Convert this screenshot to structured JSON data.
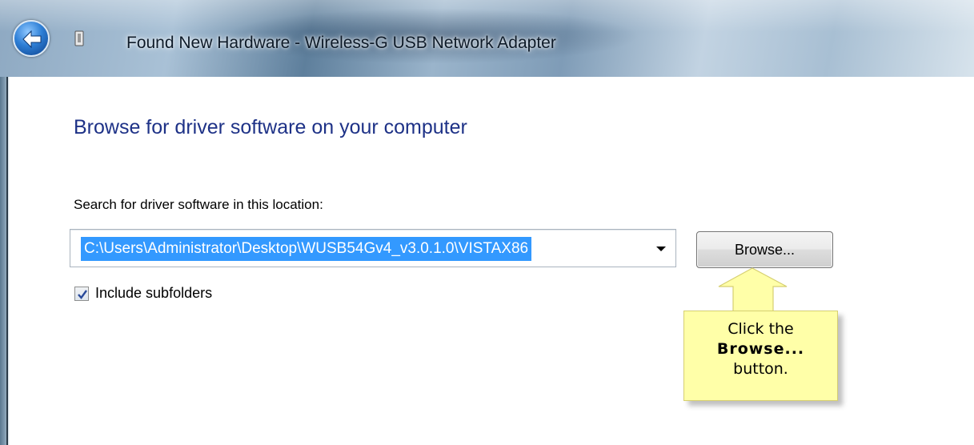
{
  "window": {
    "title": "Found New Hardware - Wireless-G USB Network Adapter"
  },
  "page": {
    "heading": "Browse for driver software on your computer",
    "search_label": "Search for driver software in this location:",
    "path_value": "C:\\Users\\Administrator\\Desktop\\WUSB54Gv4_v3.0.1.0\\VISTAX86",
    "browse_label": "Browse...",
    "include_subfolders_label": "Include subfolders",
    "include_subfolders_checked": true
  },
  "callout": {
    "line1": "Click the",
    "line2": "Browse...",
    "line3": "button."
  },
  "colors": {
    "heading": "#1e3287",
    "selection": "#3399ff",
    "callout_bg": "#ffffa8"
  },
  "icons": {
    "back": "back-arrow-icon",
    "device": "usb-device-icon",
    "checkbox_mark": "checkmark-icon",
    "dropdown": "chevron-down-icon"
  }
}
